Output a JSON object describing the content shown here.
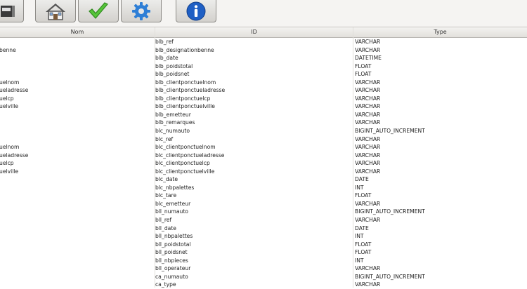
{
  "toolbar": {
    "buttons": [
      {
        "name": "partial-icon"
      },
      {
        "name": "home-icon"
      },
      {
        "name": "checkmark-icon"
      },
      {
        "name": "gear-icon"
      },
      {
        "name": "info-icon"
      }
    ]
  },
  "table": {
    "columns": [
      "Nom",
      "ID",
      "Type"
    ],
    "rows": [
      {
        "nom": "",
        "id": "blb_ref",
        "type": "VARCHAR"
      },
      {
        "nom": "benne",
        "id": "blb_designationbenne",
        "type": "VARCHAR"
      },
      {
        "nom": "",
        "id": "blb_date",
        "type": "DATETIME"
      },
      {
        "nom": "",
        "id": "blb_poidstotal",
        "type": "FLOAT"
      },
      {
        "nom": "",
        "id": "blb_poidsnet",
        "type": "FLOAT"
      },
      {
        "nom": "uelnom",
        "id": "blb_clientponctuelnom",
        "type": "VARCHAR"
      },
      {
        "nom": "ueladresse",
        "id": "blb_clientponctueladresse",
        "type": "VARCHAR"
      },
      {
        "nom": "uelcp",
        "id": "blb_clientponctuelcp",
        "type": "VARCHAR"
      },
      {
        "nom": "uelville",
        "id": "blb_clientponctuelville",
        "type": "VARCHAR"
      },
      {
        "nom": "",
        "id": "blb_emetteur",
        "type": "VARCHAR"
      },
      {
        "nom": "",
        "id": "blb_remarques",
        "type": "VARCHAR"
      },
      {
        "nom": "",
        "id": "blc_numauto",
        "type": "BIGINT_AUTO_INCREMENT"
      },
      {
        "nom": "",
        "id": "blc_ref",
        "type": "VARCHAR"
      },
      {
        "nom": "uelnom",
        "id": "blc_clientponctuelnom",
        "type": "VARCHAR"
      },
      {
        "nom": "ueladresse",
        "id": "blc_clientponctueladresse",
        "type": "VARCHAR"
      },
      {
        "nom": "uelcp",
        "id": "blc_clientponctuelcp",
        "type": "VARCHAR"
      },
      {
        "nom": "uelville",
        "id": "blc_clientponctuelville",
        "type": "VARCHAR"
      },
      {
        "nom": "",
        "id": "blc_date",
        "type": "DATE"
      },
      {
        "nom": "",
        "id": "blc_nbpalettes",
        "type": "INT"
      },
      {
        "nom": "",
        "id": "blc_tare",
        "type": "FLOAT"
      },
      {
        "nom": "",
        "id": "blc_emetteur",
        "type": "VARCHAR"
      },
      {
        "nom": "",
        "id": "bll_numauto",
        "type": "BIGINT_AUTO_INCREMENT"
      },
      {
        "nom": "",
        "id": "bll_ref",
        "type": "VARCHAR"
      },
      {
        "nom": "",
        "id": "bll_date",
        "type": "DATE"
      },
      {
        "nom": "",
        "id": "bll_nbpalettes",
        "type": "INT"
      },
      {
        "nom": "",
        "id": "bll_poidstotal",
        "type": "FLOAT"
      },
      {
        "nom": "",
        "id": "bll_poidsnet",
        "type": "FLOAT"
      },
      {
        "nom": "",
        "id": "bll_nbpieces",
        "type": "INT"
      },
      {
        "nom": "",
        "id": "bll_operateur",
        "type": "VARCHAR"
      },
      {
        "nom": "",
        "id": "ca_numauto",
        "type": "BIGINT_AUTO_INCREMENT"
      },
      {
        "nom": "",
        "id": "ca_type",
        "type": "VARCHAR"
      }
    ]
  }
}
